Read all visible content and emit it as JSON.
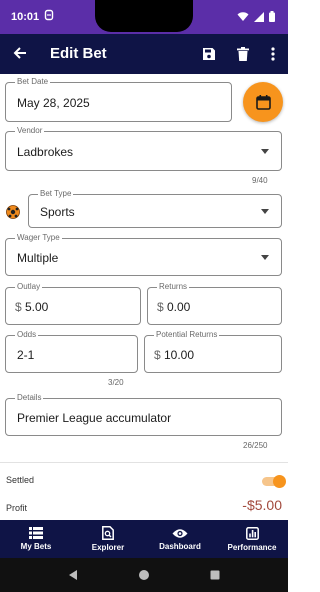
{
  "status_bar": {
    "time": "10:01"
  },
  "app_bar": {
    "title": "Edit Bet"
  },
  "form": {
    "bet_date": {
      "label": "Bet Date",
      "value": "May 28, 2025"
    },
    "vendor": {
      "label": "Vendor",
      "value": "Ladbrokes",
      "counter": "9/40"
    },
    "bet_type": {
      "label": "Bet Type",
      "value": "Sports"
    },
    "wager_type": {
      "label": "Wager Type",
      "value": "Multiple"
    },
    "outlay": {
      "label": "Outlay",
      "prefix": "$",
      "value": "5.00"
    },
    "returns": {
      "label": "Returns",
      "prefix": "$",
      "value": "0.00"
    },
    "odds": {
      "label": "Odds",
      "value": "2-1",
      "counter": "3/20"
    },
    "potential_returns": {
      "label": "Potential Returns",
      "prefix": "$",
      "value": "10.00"
    },
    "details": {
      "label": "Details",
      "value": "Premier League accumulator",
      "counter": "26/250"
    }
  },
  "settled": {
    "label": "Settled",
    "on": true
  },
  "profit": {
    "label": "Profit",
    "value": "-$5.00"
  },
  "bottom_nav": {
    "items": [
      {
        "label": "My Bets",
        "icon": "list-icon"
      },
      {
        "label": "Explorer",
        "icon": "explorer-icon"
      },
      {
        "label": "Dashboard",
        "icon": "eye-icon"
      },
      {
        "label": "Performance",
        "icon": "chart-icon"
      }
    ]
  },
  "colors": {
    "status_bar": "#5b2ea8",
    "app_bar": "#0f1446",
    "accent": "#f7941d",
    "profit_negative": "#a24a3d"
  }
}
